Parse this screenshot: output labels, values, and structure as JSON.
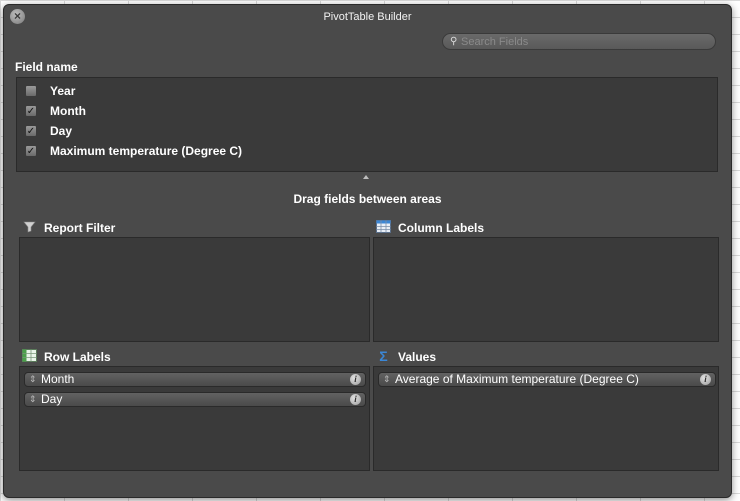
{
  "window": {
    "title": "PivotTable Builder"
  },
  "search": {
    "placeholder": "Search Fields"
  },
  "field_list": {
    "title": "Field name",
    "fields": [
      {
        "label": "Year",
        "checked": false
      },
      {
        "label": "Month",
        "checked": true
      },
      {
        "label": "Day",
        "checked": true
      },
      {
        "label": "Maximum temperature (Degree C)",
        "checked": true
      }
    ]
  },
  "drag_hint": "Drag fields between areas",
  "areas": {
    "report_filter": {
      "label": "Report Filter",
      "icon": "funnel-icon",
      "items": []
    },
    "column_labels": {
      "label": "Column Labels",
      "icon": "column-grid-icon",
      "items": []
    },
    "row_labels": {
      "label": "Row Labels",
      "icon": "row-grid-icon",
      "items": [
        "Month",
        "Day"
      ]
    },
    "values": {
      "label": "Values",
      "icon": "sigma-icon",
      "items": [
        "Average of Maximum temperature (Degree C)"
      ]
    }
  },
  "colors": {
    "panel": "#4a4a4a",
    "area": "#3a3a3a",
    "accent": "#3b87d6"
  }
}
